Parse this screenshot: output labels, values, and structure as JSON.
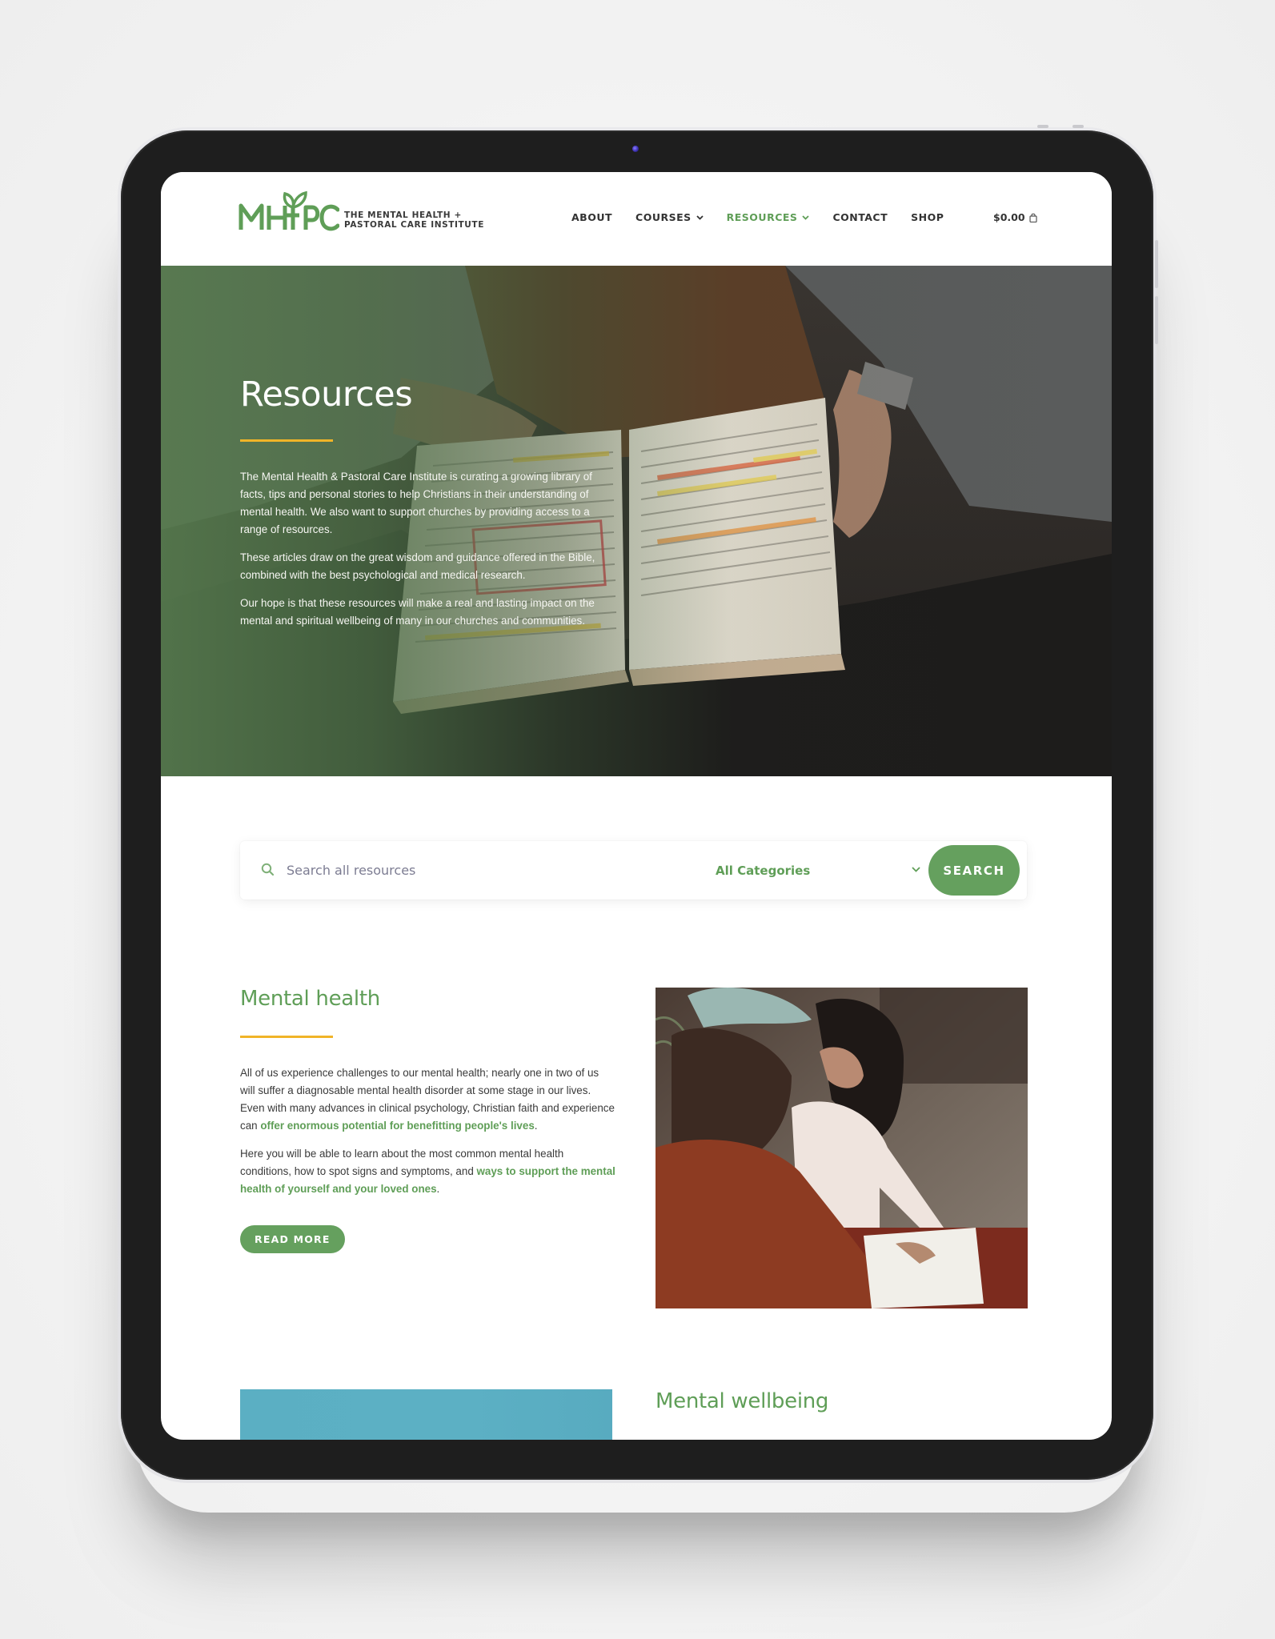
{
  "site": {
    "logo_mark": "MHPC",
    "logo_line1": "THE MENTAL HEALTH +",
    "logo_line2": "PASTORAL CARE INSTITUTE",
    "brand_green": "#5f9e57",
    "accent_gold": "#f0b428"
  },
  "nav": {
    "items": [
      {
        "label": "ABOUT",
        "has_dropdown": false,
        "active": false
      },
      {
        "label": "COURSES",
        "has_dropdown": true,
        "active": false
      },
      {
        "label": "RESOURCES",
        "has_dropdown": true,
        "active": true
      },
      {
        "label": "CONTACT",
        "has_dropdown": false,
        "active": false
      },
      {
        "label": "SHOP",
        "has_dropdown": false,
        "active": false
      }
    ],
    "cart_total": "$0.00",
    "cart_icon": "shopping-bag-icon"
  },
  "hero": {
    "title": "Resources",
    "paragraphs": [
      "The Mental Health & Pastoral Care Institute is curating a growing library of facts, tips and personal stories to help Christians in their understanding of mental health. We also want to support churches by providing access to a range of resources.",
      "These articles draw on the great wisdom and guidance offered in the Bible, combined with the best psychological and medical research.",
      "Our hope is that these resources will make a real and lasting impact on the mental and spiritual wellbeing of many in our churches and communities."
    ],
    "image_alt": "Person holding an open, highlighted Bible"
  },
  "search": {
    "placeholder": "Search all resources",
    "value": "",
    "category_selected": "All Categories",
    "button_label": "SEARCH"
  },
  "mental_health": {
    "title": "Mental health",
    "p1_text": "All of us experience challenges to our mental health; nearly one in two of us will suffer a diagnosable mental health disorder at some stage in our lives. Even with many advances in clinical psychology, Christian faith and experience can ",
    "p1_link": "offer enormous potential for benefitting people's lives",
    "p1_end": ".",
    "p2_text": "Here you will be able to learn about the most common mental health conditions, how to spot signs and symptoms, and ",
    "p2_link": "ways to support the mental health of yourself and your loved ones",
    "p2_end": ".",
    "button_label": "READ MORE",
    "image_alt": "Two women reading a book together"
  },
  "mental_wellbeing": {
    "title": "Mental wellbeing"
  }
}
